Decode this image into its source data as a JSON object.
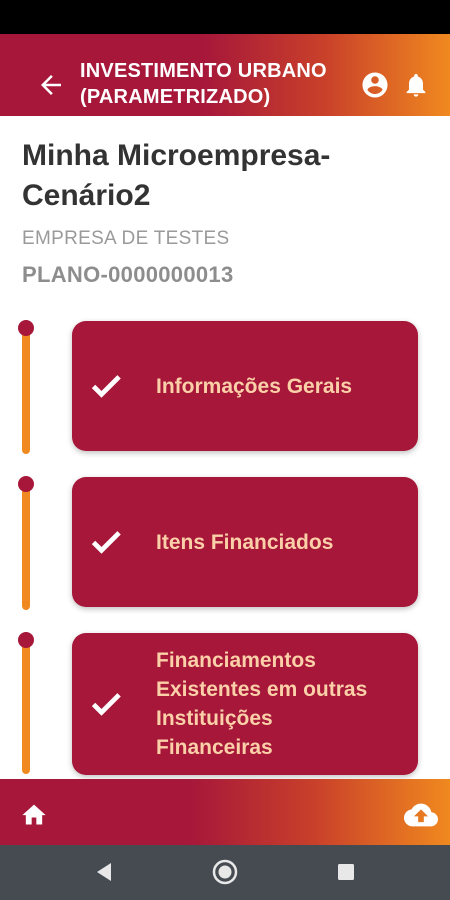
{
  "app_bar": {
    "title_line1": "INVESTIMENTO URBANO",
    "title_line2": "(PARAMETRIZADO)",
    "back_icon": "arrow-back-icon",
    "account_icon": "account-circle-icon",
    "notification_icon": "bell-icon"
  },
  "plan": {
    "name_line1": "Minha Microempresa-",
    "name_line2": "Cenário2",
    "company": "EMPRESA DE TESTES",
    "code": "PLANO-0000000013"
  },
  "steps": [
    {
      "label": "Informações Gerais",
      "completed": true
    },
    {
      "label": "Itens Financiados",
      "completed": true
    },
    {
      "label_lines": [
        "Financiamentos",
        "Existentes em outras",
        "Instituições",
        "Financeiras"
      ],
      "completed": true
    }
  ],
  "bottom_bar": {
    "home_icon": "home-icon",
    "upload_icon": "cloud-upload-icon"
  },
  "system_nav": {
    "back": "nav-back-icon",
    "home": "nav-home-icon",
    "recents": "nav-recents-icon"
  },
  "colors": {
    "primary": "#a6173a",
    "accent": "#f0891f",
    "step_text": "#fbd0a8"
  }
}
